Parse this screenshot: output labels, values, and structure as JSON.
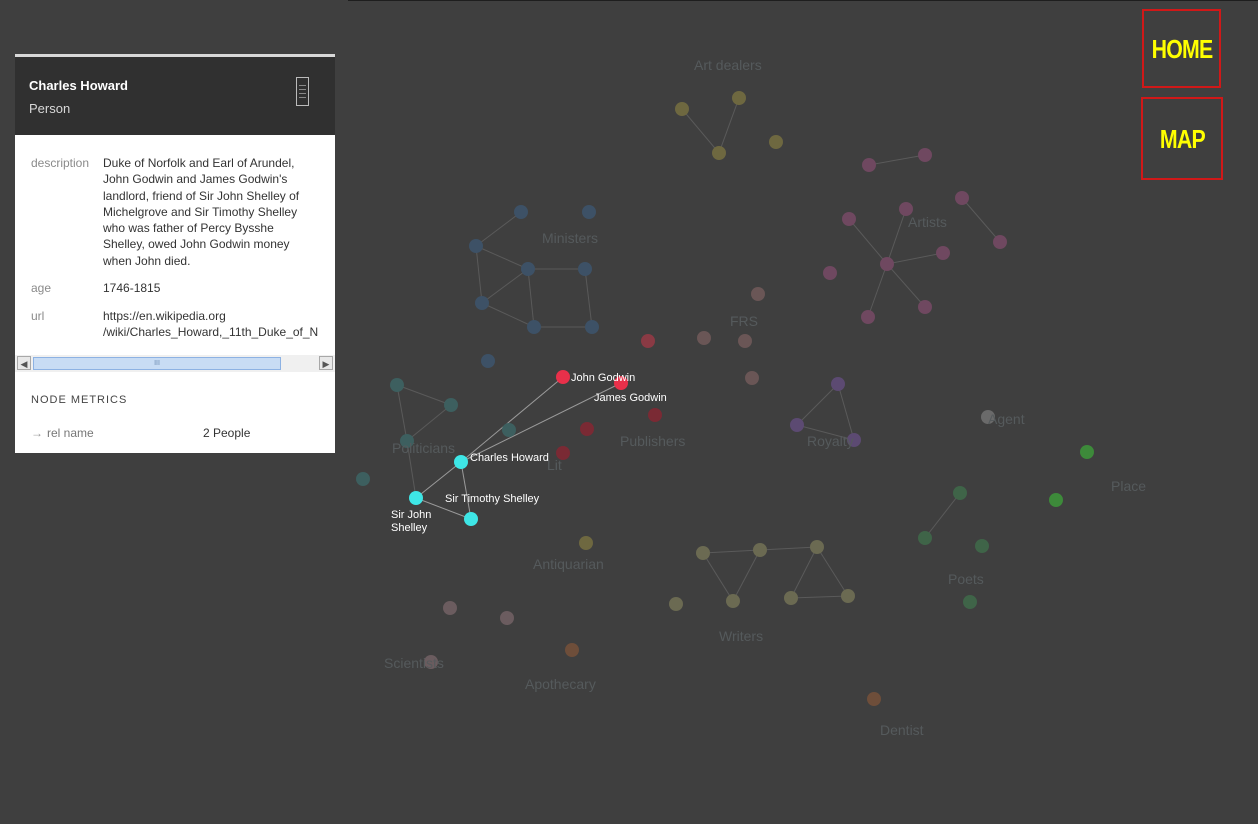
{
  "panel": {
    "title": "Charles Howard",
    "type": "Person",
    "doc_icon": "document-icon",
    "properties": [
      {
        "key": "description",
        "lines": [
          "Duke of Norfolk and Earl of Arundel,",
          "John Godwin and James Godwin's",
          "landlord, friend of Sir John Shelley of",
          "Michelgrove and Sir Timothy Shelley",
          "who was father of Percy Bysshe",
          "Shelley, owed John Godwin money",
          "when John died."
        ]
      },
      {
        "key": "age",
        "lines": [
          "1746-1815"
        ]
      },
      {
        "key": "url",
        "lines": [
          "https://en.wikipedia.org",
          "/wiki/Charles_Howard,_11th_Duke_of_N"
        ]
      }
    ],
    "scroll_thumb_grip": "III",
    "metrics_title": "NODE METRICS",
    "metric_arrow": "→",
    "metric_name": "rel name",
    "metric_value": "2 People"
  },
  "nav": {
    "home_label": "HOME",
    "map_label": "MAP"
  },
  "graph": {
    "group_labels": [
      "Art dealers",
      "Ministers",
      "Artists",
      "FRS",
      "Publishers",
      "Royalty",
      "Agent",
      "Politicians",
      "Place",
      "Antiquarian",
      "Poets",
      "Writers",
      "Scientists",
      "Apothecary",
      "Dentist",
      "Lit"
    ],
    "highlighted_labels": [
      "John Godwin",
      "James Godwin",
      "Charles Howard",
      "Sir Timothy Shelley",
      "Sir John",
      "Shelley"
    ],
    "colors": {
      "background": "#3f3f3f",
      "person_highlight": "#3ee6e6",
      "godwin_highlight": "#e8304a",
      "nav_text": "#ffff00",
      "nav_border": "#d01818"
    }
  }
}
